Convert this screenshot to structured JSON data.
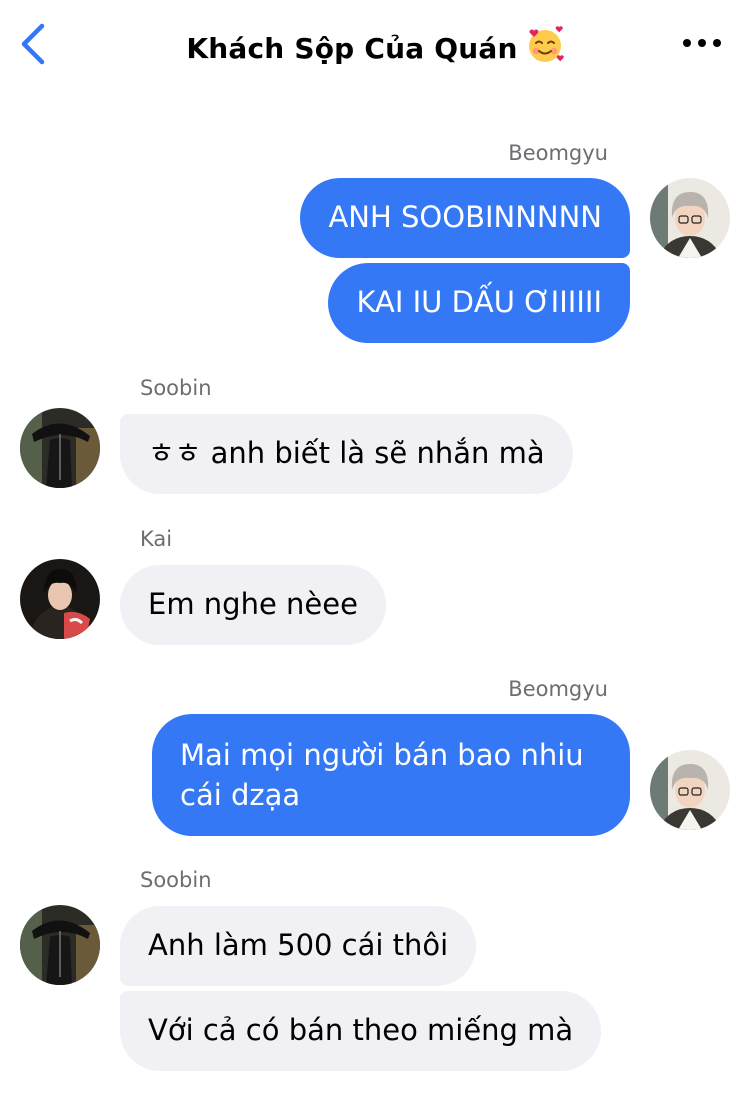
{
  "header": {
    "title": "Khách Sộp Của Quán",
    "back_icon": "chevron-left-icon",
    "title_emoji": "smiling-face-with-hearts-icon",
    "more_icon": "more-horizontal-icon",
    "accent_color": "#3478f6"
  },
  "messages": [
    {
      "sender": "Beomgyu",
      "direction": "outgoing",
      "bubbles": [
        "ANH SOOBINNNNN",
        "KAI IU DẤU ƠIIIIII"
      ],
      "avatar": "beomgyu-avatar"
    },
    {
      "sender": "Soobin",
      "direction": "incoming",
      "bubbles": [
        "ㅎㅎ anh biết là sẽ nhắn mà"
      ],
      "avatar": "soobin-avatar"
    },
    {
      "sender": "Kai",
      "direction": "incoming",
      "bubbles": [
        "Em nghe nèee"
      ],
      "avatar": "kai-avatar"
    },
    {
      "sender": "Beomgyu",
      "direction": "outgoing",
      "bubbles": [
        "Mai mọi người bán bao nhiu cái dzạa"
      ],
      "avatar": "beomgyu-avatar"
    },
    {
      "sender": "Soobin",
      "direction": "incoming",
      "bubbles": [
        "Anh làm 500 cái thôi",
        "Với cả có bán theo miếng mà"
      ],
      "avatar": "soobin-avatar"
    }
  ]
}
